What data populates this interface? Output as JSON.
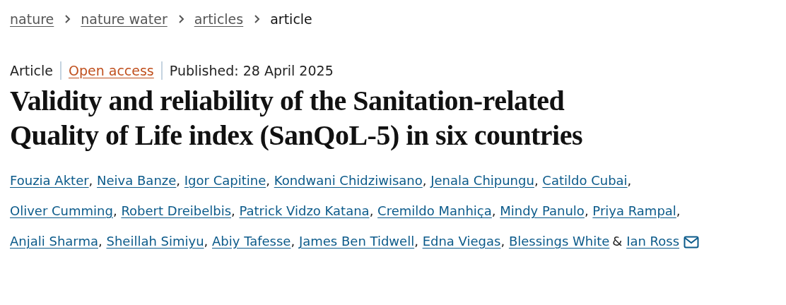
{
  "breadcrumbs": [
    {
      "label": "nature",
      "link": true
    },
    {
      "label": "nature water",
      "link": true
    },
    {
      "label": "articles",
      "link": true
    },
    {
      "label": "article",
      "link": false
    }
  ],
  "meta": [
    {
      "kind": "type",
      "text": "Article"
    },
    {
      "kind": "access",
      "text": "Open access"
    },
    {
      "kind": "date",
      "text": "Published: 28 April 2025"
    }
  ],
  "title": "Validity and reliability of the Sanitation-related Quality of Life index (SanQoL-5) in six countries",
  "authors": [
    {
      "name": "Fouzia Akter",
      "separator": ","
    },
    {
      "name": "Neiva Banze",
      "separator": ","
    },
    {
      "name": "Igor Capitine",
      "separator": ","
    },
    {
      "name": "Kondwani Chidziwisano",
      "separator": ","
    },
    {
      "name": "Jenala Chipungu",
      "separator": ","
    },
    {
      "name": "Catildo Cubai",
      "separator": ","
    },
    {
      "name": "Oliver Cumming",
      "separator": ","
    },
    {
      "name": "Robert Dreibelbis",
      "separator": ","
    },
    {
      "name": "Patrick Vidzo Katana",
      "separator": ","
    },
    {
      "name": "Cremildo Manhiça",
      "separator": ","
    },
    {
      "name": "Mindy Panulo",
      "separator": ","
    },
    {
      "name": "Priya Rampal",
      "separator": ","
    },
    {
      "name": "Anjali Sharma",
      "separator": ","
    },
    {
      "name": "Sheillah Simiyu",
      "separator": ","
    },
    {
      "name": "Abiy Tafesse",
      "separator": ","
    },
    {
      "name": "James Ben Tidwell",
      "separator": ","
    },
    {
      "name": "Edna Viegas",
      "separator": ","
    },
    {
      "name": "Blessings White",
      "separator": "&"
    },
    {
      "name": "Ian Ross",
      "email": true
    }
  ]
}
